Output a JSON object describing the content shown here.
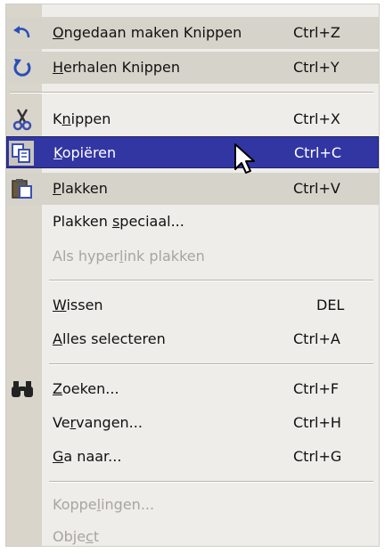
{
  "menu": {
    "items": [
      {
        "pre": "",
        "u": "O",
        "post": "ngedaan maken Knippen",
        "shortcut": "Ctrl+Z",
        "icon": "undo-icon"
      },
      {
        "pre": "",
        "u": "H",
        "post": "erhalen Knippen",
        "shortcut": "Ctrl+Y",
        "icon": "redo-icon"
      },
      {
        "pre": "K",
        "u": "n",
        "post": "ippen",
        "shortcut": "Ctrl+X",
        "icon": "scissors-icon"
      },
      {
        "pre": "",
        "u": "K",
        "post": "opiëren",
        "shortcut": "Ctrl+C",
        "icon": "copy-icon"
      },
      {
        "pre": "",
        "u": "P",
        "post": "lakken",
        "shortcut": "Ctrl+V",
        "icon": "paste-icon"
      },
      {
        "pre": "Plakken ",
        "u": "s",
        "post": "peciaal...",
        "shortcut": ""
      },
      {
        "pre": "Als hyper",
        "u": "l",
        "post": "ink plakken",
        "shortcut": ""
      },
      {
        "pre": "",
        "u": "W",
        "post": "issen",
        "shortcut": "DEL"
      },
      {
        "pre": "",
        "u": "A",
        "post": "lles selecteren",
        "shortcut": "Ctrl+A"
      },
      {
        "pre": "",
        "u": "Z",
        "post": "oeken...",
        "shortcut": "Ctrl+F",
        "icon": "binoculars-icon"
      },
      {
        "pre": "Ve",
        "u": "r",
        "post": "vangen...",
        "shortcut": "Ctrl+H"
      },
      {
        "pre": "",
        "u": "G",
        "post": "a naar...",
        "shortcut": "Ctrl+G"
      },
      {
        "pre": "Koppe",
        "u": "l",
        "post": "ingen...",
        "shortcut": ""
      },
      {
        "pre": "Obje",
        "u": "c",
        "post": "t",
        "shortcut": ""
      }
    ],
    "selected_item": "Kopiëren",
    "disabled_items": [
      "Als hyperlink plakken",
      "Koppelingen...",
      "Object"
    ],
    "colors": {
      "highlight": "#3236a3",
      "menu_bg": "#eeedea",
      "icon_strip": "#d9d5cb",
      "disabled_text": "#a8a59e"
    }
  }
}
